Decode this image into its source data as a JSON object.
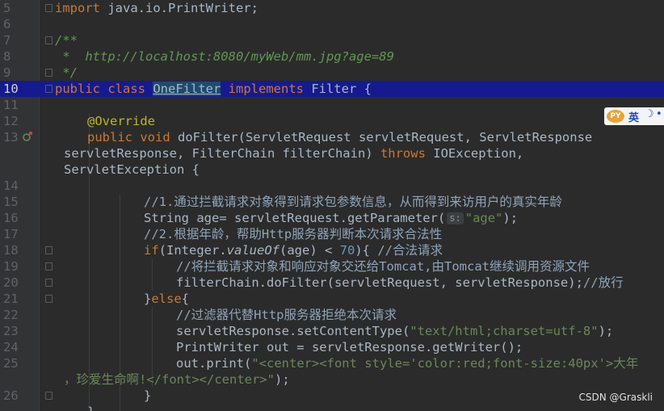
{
  "editor": {
    "current_line": "10",
    "line_numbers": [
      "5",
      "6",
      "7",
      "8",
      "9",
      "10",
      "11",
      "12",
      "13",
      "",
      "",
      "14",
      "15",
      "16",
      "17",
      "18",
      "19",
      "20",
      "21",
      "22",
      "23",
      "24",
      "25",
      "",
      "26"
    ],
    "code": {
      "l5": {
        "kw": "import",
        "rest": " java.io.PrintWriter;"
      },
      "l7": "/**",
      "l8": {
        "prefix": " *  ",
        "link": "http://localhost:8080/myWeb/mm.jpg?age=89"
      },
      "l9": " */",
      "l10": {
        "kw1": "public class ",
        "cls": "OneFilter",
        "kw2": " implements ",
        "rest": "Filter {"
      },
      "l12": "@Override",
      "l13": {
        "kw1": "public void ",
        "rest": "doFilter(ServletRequest servletRequest, ServletResponse"
      },
      "l13b": {
        "rest": "servletResponse, FilterChain filterChain) ",
        "kw": "throws",
        "rest2": " IOException,"
      },
      "l13c": "ServletException {",
      "l15": "//1.通过拦截请求对象得到请求包参数信息，从而得到来访用户的真实年龄",
      "l16": {
        "pre": "String age= servletRequest.getParameter(",
        "hint": "s:",
        "str": "\"age\"",
        "post": ");"
      },
      "l17": "//2.根据年龄，帮助Http服务器判断本次请求合法性",
      "l18": {
        "kw": "if",
        "pre": "(Integer.",
        "ital": "valueOf",
        "mid": "(age) < ",
        "num": "70",
        "post": "){ ",
        "cm": "//合法请求"
      },
      "l19": "//将拦截请求对象和响应对象交还给Tomcat,由Tomcat继续调用资源文件",
      "l20": {
        "code": "filterChain.doFilter(servletRequest, servletResponse);",
        "cm": "//放行"
      },
      "l21": {
        "pre": "}",
        "kw": "else",
        "post": "{"
      },
      "l22": "//过滤器代替Http服务器拒绝本次请求",
      "l23": {
        "pre": "servletResponse.setContentType(",
        "str": "\"text/html;charset=utf-8\"",
        "post": ");"
      },
      "l24": "PrintWriter out = servletResponse.getWriter();",
      "l25": {
        "pre": "out.print(",
        "str": "\"<center><font style='color:red;font-size:40px'>大年"
      },
      "l25b": {
        "str": "，珍爱生命啊!</font></center>\"",
        "post": ");"
      },
      "l26": "}",
      "l27": "}"
    }
  },
  "ime": {
    "logo": "PY",
    "lang": "英",
    "moon": "☽",
    "dot": "•"
  },
  "watermark": "CSDN @Graskli"
}
